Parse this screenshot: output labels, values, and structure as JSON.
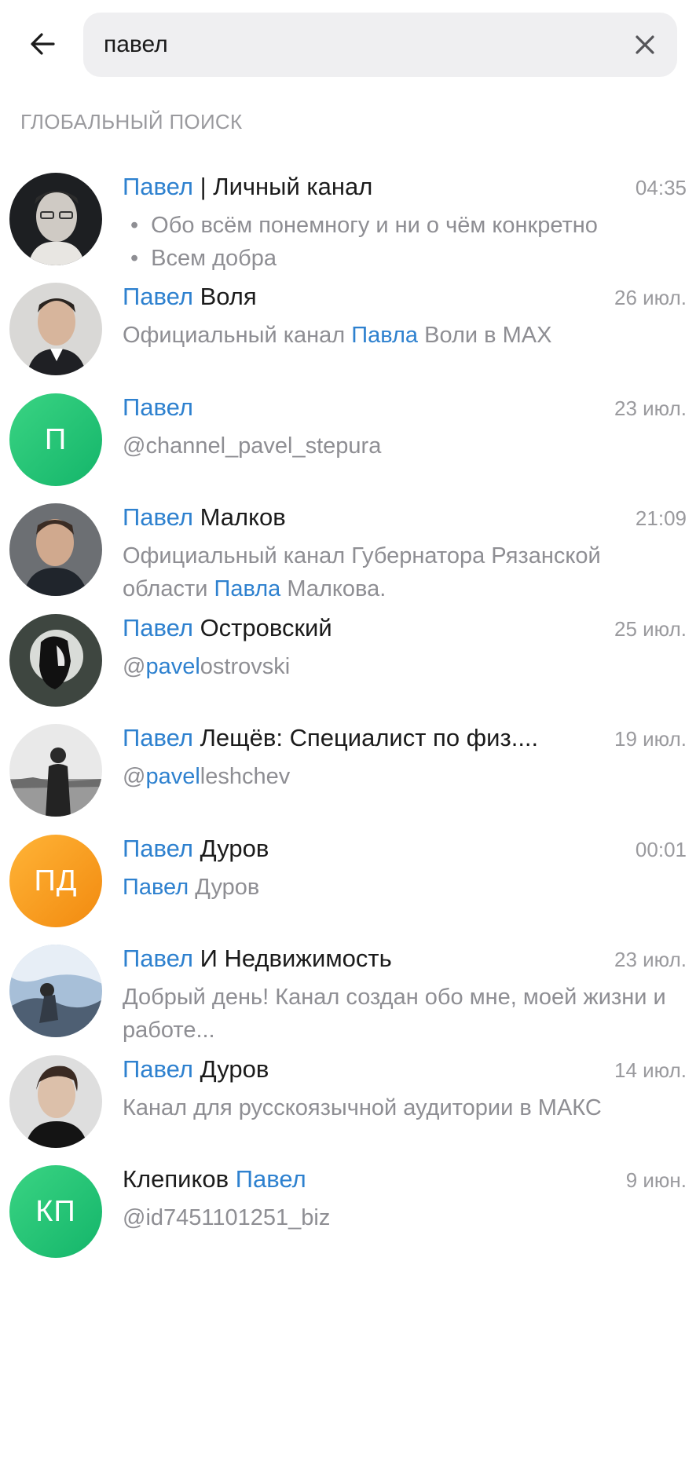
{
  "header": {
    "search_value": "павел",
    "section_title": "ГЛОБАЛЬНЫЙ ПОИСК"
  },
  "colors": {
    "highlight": "#2e81cf",
    "secondary_text": "#8e8e93",
    "search_bg": "#efeff1"
  },
  "icons": {
    "back": "arrow-left-icon",
    "clear": "close-icon"
  },
  "results": [
    {
      "title_hl": "Павел",
      "title_rest": " | Личный канал",
      "time": "04:35",
      "lines": [
        {
          "bullet": "•",
          "text": "Обо всём понемногу и ни о чём конкретно"
        },
        {
          "bullet": "•",
          "text": "Всем добра"
        }
      ]
    },
    {
      "title_hl": "Павел",
      "title_rest": " Воля",
      "time": "26 июл.",
      "sub_pre": "Официальный канал ",
      "sub_hl": "Павла",
      "sub_post": " Воли в MAX"
    },
    {
      "title_hl": "Павел",
      "title_rest": "",
      "time": "23 июл.",
      "initials": "П",
      "sub_pre": "@channel_pavel_stepura"
    },
    {
      "title_hl": "Павел",
      "title_rest": " Малков",
      "time": "21:09",
      "sub_pre": "Официальный канал Губернатора Рязанской области ",
      "sub_hl": "Павла",
      "sub_post": " Малкова."
    },
    {
      "title_hl": "Павел",
      "title_rest": " Островский",
      "time": "25 июл.",
      "sub_pre": "@",
      "sub_hl": "pavel",
      "sub_post": "ostrovski"
    },
    {
      "title_hl": "Павел",
      "title_rest": " Лещёв: Специалист по физ....",
      "time": "19 июл.",
      "sub_pre": "@",
      "sub_hl": "pavel",
      "sub_post": "leshchev"
    },
    {
      "title_hl": "Павел",
      "title_rest": " Дуров",
      "time": "00:01",
      "initials": "ПД",
      "sub_hl": "Павел",
      "sub_post": " Дуров"
    },
    {
      "title_hl": "Павел",
      "title_rest": " И Недвижимость",
      "time": "23 июл.",
      "sub_pre": "Добрый день! Канал создан обо мне, моей жизни и работе..."
    },
    {
      "title_hl": "Павел",
      "title_rest": " Дуров",
      "time": "14 июл.",
      "sub_pre": "Канал для русскоязычной аудитории в МАКС"
    },
    {
      "title_pre": "Клепиков ",
      "title_hl": "Павел",
      "time": "9 июн.",
      "initials": "КП",
      "sub_pre": "@id7451101251_biz"
    }
  ]
}
